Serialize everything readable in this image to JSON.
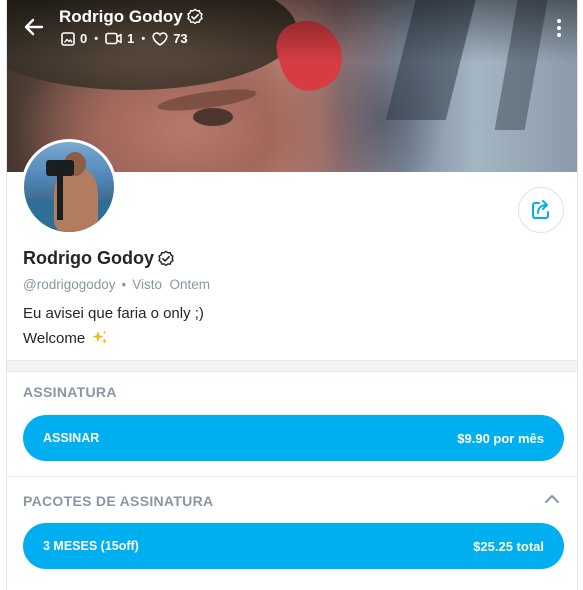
{
  "header": {
    "name": "Rodrigo Godoy",
    "stats": [
      {
        "icon": "image-icon",
        "value": "0"
      },
      {
        "icon": "video-icon",
        "value": "1"
      },
      {
        "icon": "heart-icon",
        "value": "73"
      }
    ]
  },
  "profile": {
    "name": "Rodrigo Godoy",
    "handle": "@rodrigogodoy",
    "separator": "•",
    "last_seen": "Visto  Ontem",
    "bio_line1": "Eu avisei que faria o only ;)",
    "bio_line2": "Welcome",
    "bio_emoji": "sparkles-emoji"
  },
  "subscription": {
    "title": "ASSINATURA",
    "button_label": "ASSINAR",
    "button_price": "$9.90 por mês"
  },
  "bundles": {
    "title": "PACOTES DE ASSINATURA",
    "items": [
      {
        "label": "3 MESES (15off)",
        "price": "$25.25 total"
      }
    ]
  },
  "colors": {
    "accent": "#00aff0",
    "muted_text": "#8a96a3",
    "text": "#242529",
    "divider": "#f1f2f4"
  }
}
